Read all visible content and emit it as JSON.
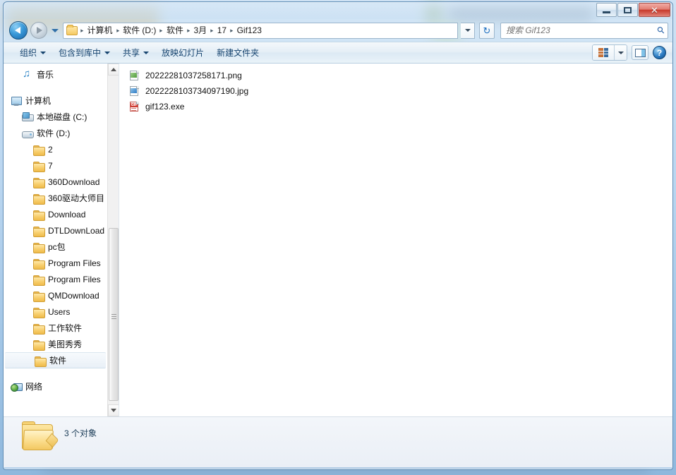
{
  "window": {
    "title": "",
    "buttons": {
      "minimize": "minimize",
      "maximize": "maximize",
      "close": "✕"
    }
  },
  "navigation": {
    "back_label": "后退",
    "forward_label": "前进",
    "recent_label": "最近浏览的位置",
    "refresh_label": "↻",
    "breadcrumb": [
      "计算机",
      "软件 (D:)",
      "软件",
      "3月",
      "17",
      "Gif123"
    ],
    "separator": "▸"
  },
  "search": {
    "placeholder": "搜索 Gif123",
    "value": "",
    "icon": "search-icon"
  },
  "toolbar": {
    "items": [
      {
        "label": "组织",
        "has_caret": true
      },
      {
        "label": "包含到库中",
        "has_caret": true
      },
      {
        "label": "共享",
        "has_caret": true
      },
      {
        "label": "放映幻灯片",
        "has_caret": false
      },
      {
        "label": "新建文件夹",
        "has_caret": false
      }
    ],
    "views_label": "更改您的视图",
    "preview_label": "显示预览窗格",
    "help_label": "?"
  },
  "sidebar": {
    "items": [
      {
        "label": "音乐",
        "icon": "music-icon",
        "indent": 1,
        "selected": false
      },
      {
        "label": "计算机",
        "icon": "computer-icon",
        "indent": 0,
        "selected": false
      },
      {
        "label": "本地磁盘 (C:)",
        "icon": "drive-c-icon",
        "indent": 1,
        "selected": false
      },
      {
        "label": "软件 (D:)",
        "icon": "drive-icon",
        "indent": 1,
        "selected": false
      },
      {
        "label": "2",
        "icon": "folder-icon",
        "indent": 2,
        "selected": false
      },
      {
        "label": "7",
        "icon": "folder-icon",
        "indent": 2,
        "selected": false
      },
      {
        "label": "360Download",
        "icon": "folder-icon",
        "indent": 2,
        "selected": false
      },
      {
        "label": "360驱动大师目",
        "icon": "folder-icon",
        "indent": 2,
        "selected": false
      },
      {
        "label": "Download",
        "icon": "folder-icon",
        "indent": 2,
        "selected": false
      },
      {
        "label": "DTLDownLoad",
        "icon": "folder-icon",
        "indent": 2,
        "selected": false
      },
      {
        "label": "pc包",
        "icon": "folder-icon",
        "indent": 2,
        "selected": false
      },
      {
        "label": "Program Files",
        "icon": "folder-icon",
        "indent": 2,
        "selected": false
      },
      {
        "label": "Program Files",
        "icon": "folder-icon",
        "indent": 2,
        "selected": false
      },
      {
        "label": "QMDownload",
        "icon": "folder-icon",
        "indent": 2,
        "selected": false
      },
      {
        "label": "Users",
        "icon": "folder-icon",
        "indent": 2,
        "selected": false
      },
      {
        "label": "工作软件",
        "icon": "folder-icon",
        "indent": 2,
        "selected": false
      },
      {
        "label": "美图秀秀",
        "icon": "folder-icon",
        "indent": 2,
        "selected": false
      },
      {
        "label": "软件",
        "icon": "folder-icon",
        "indent": 2,
        "selected": true
      },
      {
        "label": "网络",
        "icon": "network-icon",
        "indent": 0,
        "selected": false
      }
    ]
  },
  "files": [
    {
      "name": "20222281037258171.png",
      "type": "png"
    },
    {
      "name": "2022228103734097190.jpg",
      "type": "jpg"
    },
    {
      "name": "gif123.exe",
      "type": "exe"
    }
  ],
  "status": {
    "count_text": "3 个对象"
  },
  "colors": {
    "accent": "#1664a8",
    "close_red": "#c8392b",
    "folder_yellow": "#f3c65c",
    "selected_bg": "#e9f0f7",
    "text": "#101010"
  }
}
